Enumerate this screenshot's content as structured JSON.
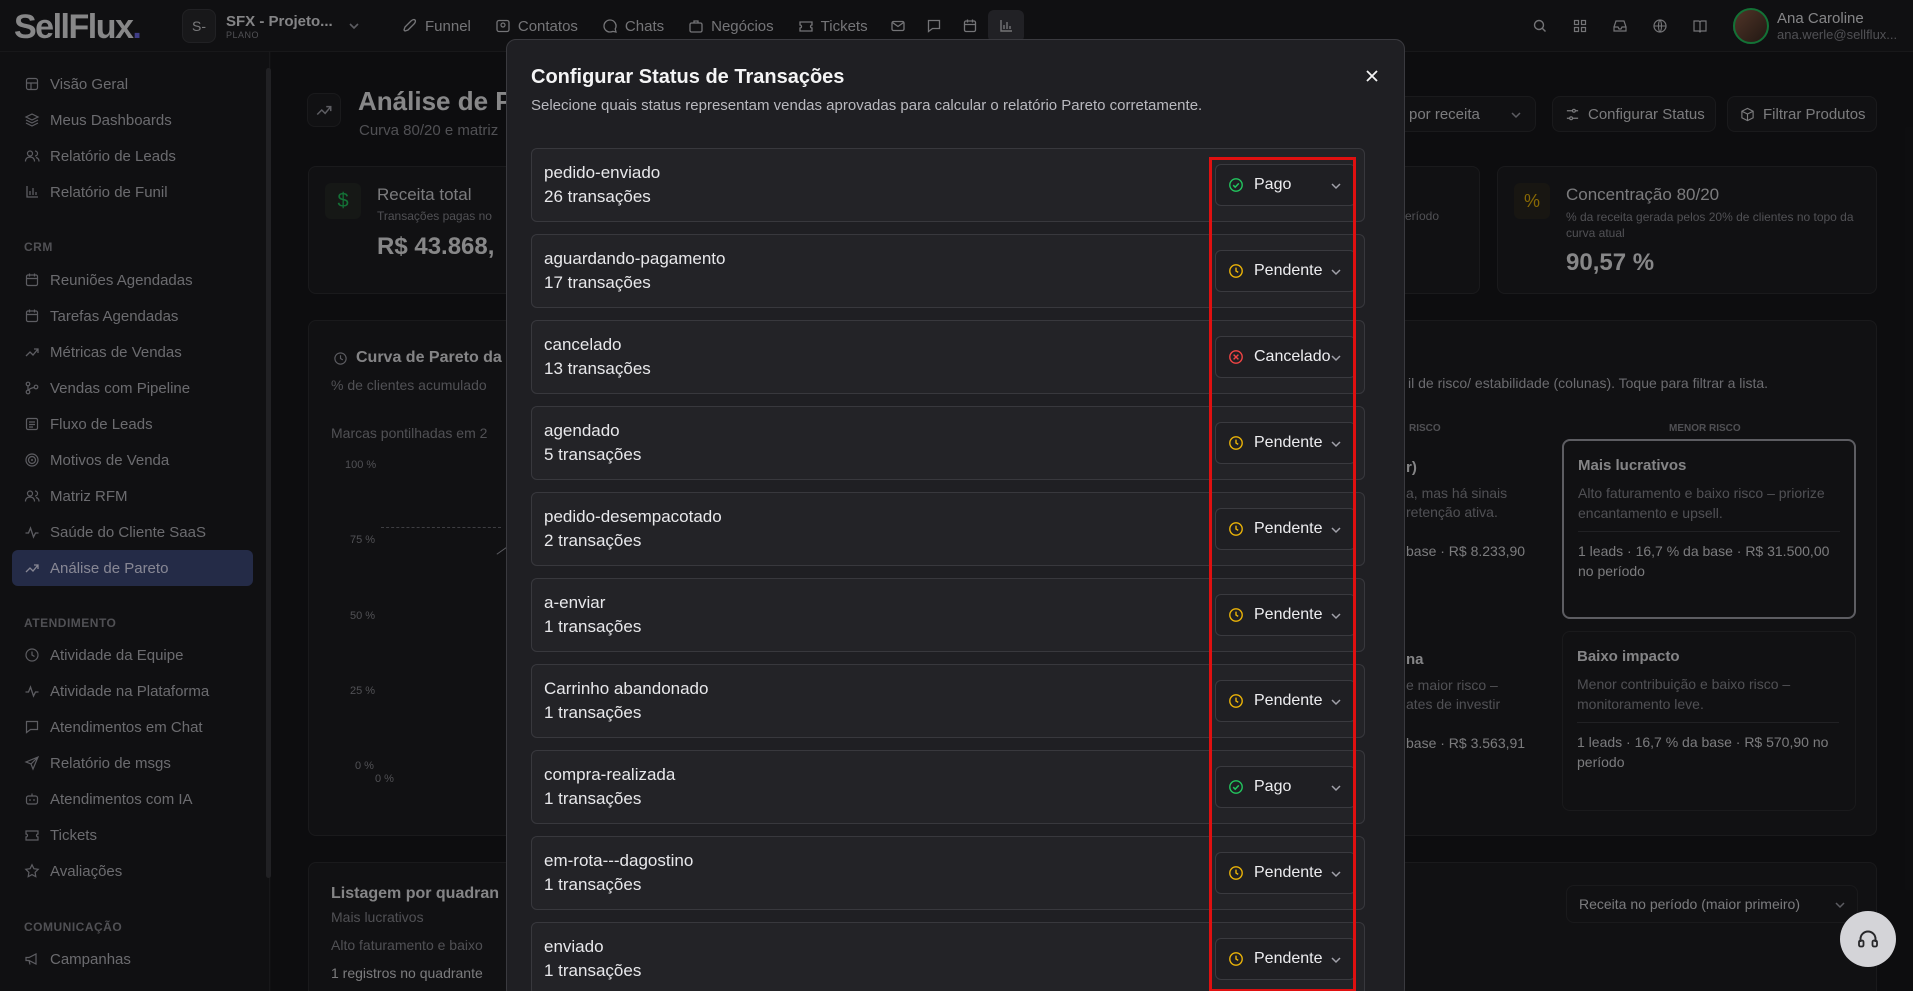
{
  "topbar": {
    "logo_text": "SellFlux",
    "logo_dot": ".",
    "project_initial": "S-",
    "project_name": "SFX - Projeto...",
    "project_plan": "PLANO",
    "nav": [
      {
        "label": "Funnel",
        "icon": "rocket-icon"
      },
      {
        "label": "Contatos",
        "icon": "contact-card-icon"
      },
      {
        "label": "Chats",
        "icon": "chat-bubble-icon"
      },
      {
        "label": "Negócios",
        "icon": "briefcase-icon"
      },
      {
        "label": "Tickets",
        "icon": "ticket-icon"
      }
    ],
    "user_name": "Ana Caroline",
    "user_email": "ana.werle@sellflux..."
  },
  "sidebar": {
    "items_top": [
      "Visão Geral",
      "Meus Dashboards",
      "Relatório de Leads",
      "Relatório de Funil"
    ],
    "crm_heading": "CRM",
    "crm_items": [
      "Reuniões Agendadas",
      "Tarefas Agendadas",
      "Métricas de Vendas",
      "Vendas com Pipeline",
      "Fluxo de Leads",
      "Motivos de Venda",
      "Matriz RFM",
      "Saúde do Cliente SaaS",
      "Análise de Pareto"
    ],
    "atendimento_heading": "ATENDIMENTO",
    "atendimento_items": [
      "Atividade da Equipe",
      "Atividade na Plataforma",
      "Atendimentos em Chat",
      "Relatório de msgs",
      "Atendimentos com IA",
      "Tickets",
      "Avaliações"
    ],
    "comunicacao_heading": "COMUNICAÇÃO",
    "comunicacao_items": [
      "Campanhas"
    ]
  },
  "main": {
    "page_title": "Análise de Pa",
    "page_subtitle": "Curva 80/20 e matriz",
    "sort_label": "por receita",
    "configure_status_button": "Configurar Status",
    "filter_products_button": "Filtrar Produtos",
    "kpi_revenue_title": "Receita total",
    "kpi_revenue_sub": "Transações pagas no",
    "kpi_revenue_value": "R$ 43.868,",
    "kpi_period_fragment": "eríodo",
    "kpi_conc_title": "Concentração 80/20",
    "kpi_conc_sub": "% da receita gerada pelos 20% de clientes no topo da curva atual",
    "kpi_conc_value": "90,57 %",
    "pareto_title": "Curva de Pareto da",
    "pareto_sub": "% de clientes acumulado",
    "pareto_note": "Marcas pontilhadas em 2",
    "axis_ticks": [
      "100 %",
      "75 %",
      "50 %",
      "25 %",
      "0 %"
    ],
    "axis_x0": "0 %",
    "matrix_hint": "il de risco/ estabilidade (colunas). Toque para filtrar a lista.",
    "col_risk_fragment": "RISCO",
    "col_menor_risco": "MENOR RISCO",
    "q1_title_fragment": "r)",
    "q1_desc_fragment": "a, mas há sinais",
    "q1_desc2_fragment": "retenção ativa.",
    "q1_stats_fragment": "base · R$ 8.233,90",
    "q2_title": "Mais lucrativos",
    "q2_desc": "Alto faturamento e baixo risco – priorize encantamento e upsell.",
    "q2_stats": "1 leads · 16,7 % da base · R$ 31.500,00 no período",
    "q3_title_fragment": "na",
    "q3_desc_fragment": "e maior risco –",
    "q3_desc2_fragment": "ates de investir",
    "q3_stats_fragment": "base · R$ 3.563,91",
    "q4_title": "Baixo impacto",
    "q4_desc": "Menor contribuição e baixo risco – monitoramento leve.",
    "q4_stats": "1 leads · 16,7 % da base · R$ 570,90 no período",
    "list_title": "Listagem por quadran",
    "list_sub": "Mais lucrativos",
    "list_desc": "Alto faturamento e baixo",
    "list_count": "1 registros no quadrante",
    "list_sort": "Receita no período (maior primeiro)"
  },
  "modal": {
    "title": "Configurar Status de Transações",
    "subtitle": "Selecione quais status representam vendas aprovadas para calcular o relatório Pareto corretamente.",
    "rows": [
      {
        "name": "pedido-enviado",
        "count": "26 transações",
        "status": "Pago",
        "kind": "paid"
      },
      {
        "name": "aguardando-pagamento",
        "count": "17 transações",
        "status": "Pendente",
        "kind": "pending"
      },
      {
        "name": "cancelado",
        "count": "13 transações",
        "status": "Cancelado",
        "kind": "cancelled"
      },
      {
        "name": "agendado",
        "count": "5 transações",
        "status": "Pendente",
        "kind": "pending"
      },
      {
        "name": "pedido-desempacotado",
        "count": "2 transações",
        "status": "Pendente",
        "kind": "pending"
      },
      {
        "name": "a-enviar",
        "count": "1 transações",
        "status": "Pendente",
        "kind": "pending"
      },
      {
        "name": "Carrinho abandonado",
        "count": "1 transações",
        "status": "Pendente",
        "kind": "pending"
      },
      {
        "name": "compra-realizada",
        "count": "1 transações",
        "status": "Pago",
        "kind": "paid"
      },
      {
        "name": "em-rota---dagostino",
        "count": "1 transações",
        "status": "Pendente",
        "kind": "pending"
      },
      {
        "name": "enviado",
        "count": "1 transações",
        "status": "Pendente",
        "kind": "pending"
      }
    ]
  },
  "colors": {
    "paid": "#22c55e",
    "pending": "#eab308",
    "cancelled": "#ef4444",
    "highlight": "#e01010",
    "accent": "#6d6ae8"
  }
}
